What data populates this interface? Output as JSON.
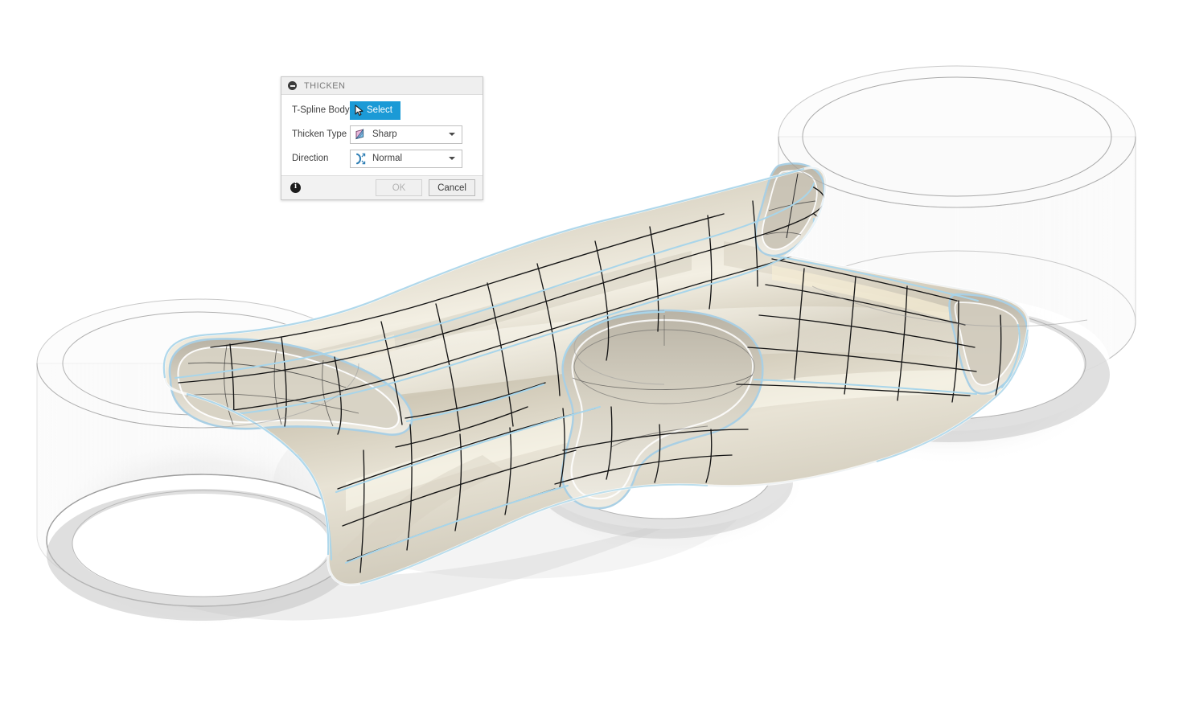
{
  "app": {
    "background_color": "#ffffff"
  },
  "dialog": {
    "title": "THICKEN",
    "collapse_icon": "circle-minus-icon",
    "rows": [
      {
        "label": "T-Spline Body",
        "control": "select-button",
        "value": "Select",
        "icon": "cursor-arrow-icon"
      },
      {
        "label": "Thicken Type",
        "control": "dropdown",
        "value": "Sharp",
        "icon": "sharp-thicken-icon"
      },
      {
        "label": "Direction",
        "control": "dropdown",
        "value": "Normal",
        "icon": "normal-direction-icon"
      }
    ],
    "footer": {
      "info_icon": "info-icon",
      "ok_label": "OK",
      "ok_enabled": false,
      "cancel_label": "Cancel",
      "cancel_enabled": true
    },
    "colors": {
      "accent": "#1b9ad6",
      "title_bar": "#efefef",
      "body": "#ffffff",
      "footer": "#f2f2f2",
      "border": "#c8c8c8",
      "disabled_text": "#b3b3b3"
    }
  },
  "viewport": {
    "name": "3d-modeling-canvas",
    "model": {
      "name": "t-spline-surface-body",
      "description": "Organic four-armed T-Spline saddle surface with a central opening",
      "surface_color": "#ded9cb",
      "highlight_color": "#f6f2e6",
      "mesh_edge_color": "#111111",
      "tspline_edge_color": "#a6d4ea",
      "shadow_color": "#c9c9c9"
    },
    "reference_bodies": {
      "name": "transparent-cylinders",
      "count": 4,
      "fill_color": "#f2f2f2",
      "edge_color": "#9a9a9a"
    }
  }
}
